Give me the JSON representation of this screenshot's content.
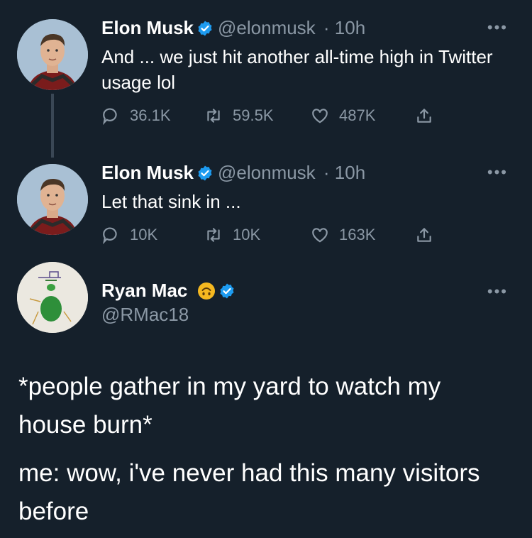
{
  "tweets": [
    {
      "name": "Elon Musk",
      "handle": "@elonmusk",
      "time": "· 10h",
      "text": "And ... we just hit another all-time high in Twitter usage lol",
      "replies": "36.1K",
      "retweets": "59.5K",
      "likes": "487K"
    },
    {
      "name": "Elon Musk",
      "handle": "@elonmusk",
      "time": "· 10h",
      "text": "Let that sink in ...",
      "replies": "10K",
      "retweets": "10K",
      "likes": "163K"
    },
    {
      "name": "Ryan Mac",
      "handle": "@RMac18",
      "emoji": "upside-down-face"
    }
  ],
  "post_text": [
    "*people gather in my yard to watch my house burn*",
    "me: wow, i've never had this many visitors before"
  ],
  "colors": {
    "background": "#15202b",
    "verified": "#1d9bf0",
    "muted": "#8b98a5"
  }
}
